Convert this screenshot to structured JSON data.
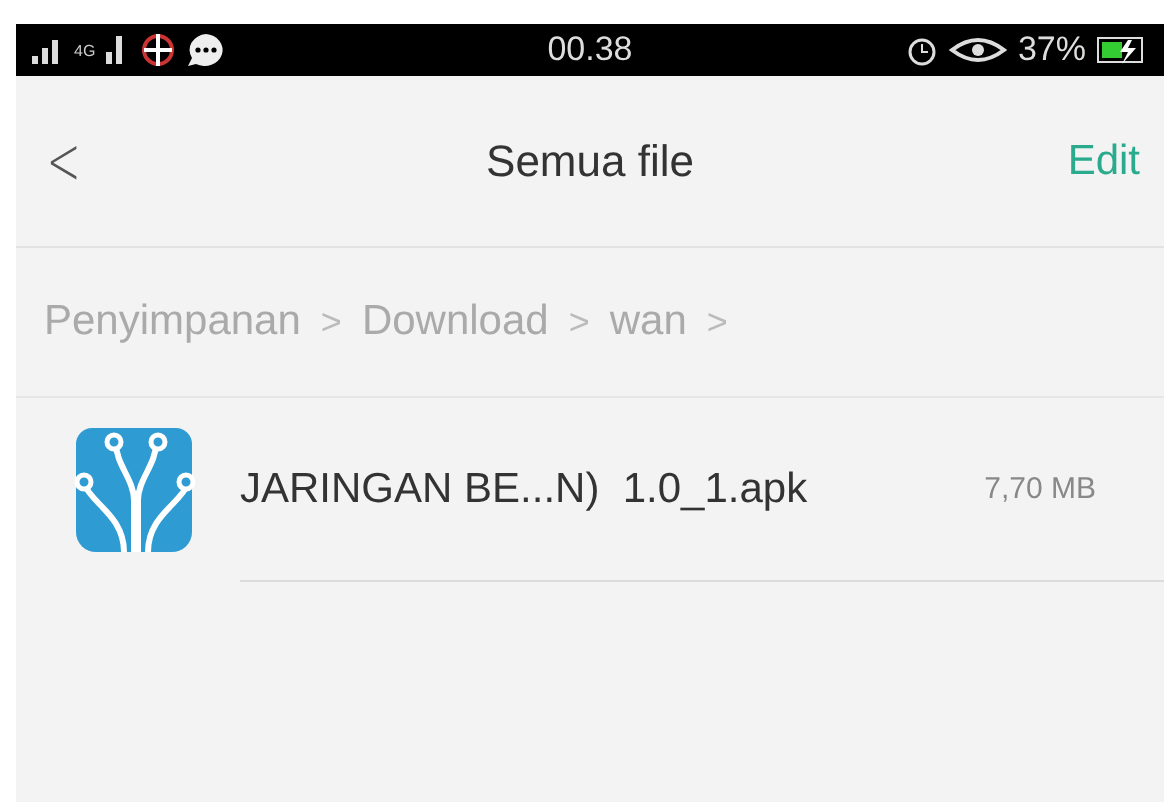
{
  "status_bar": {
    "network": "4G",
    "time": "00.38",
    "battery": "37%"
  },
  "header": {
    "back": "<",
    "title": "Semua file",
    "action": "Edit"
  },
  "breadcrumb": [
    {
      "label": "Penyimpanan",
      "separator": ">"
    },
    {
      "label": "Download",
      "separator": ">"
    },
    {
      "label": "wan",
      "separator": ">"
    }
  ],
  "files": [
    {
      "name": "JARINGAN BE...N)  1.0_1.apk",
      "size": "7,70 MB"
    }
  ]
}
